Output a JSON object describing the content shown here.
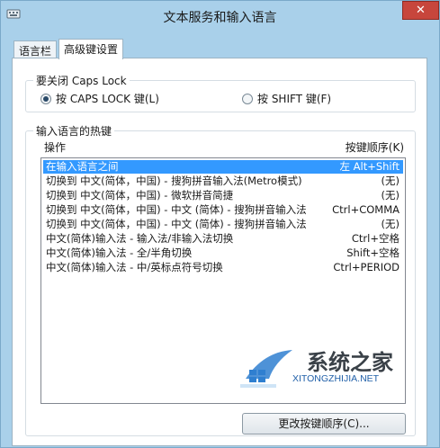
{
  "window": {
    "title": "文本服务和输入语言"
  },
  "tabs": [
    {
      "label": "语言栏"
    },
    {
      "label": "高级键设置"
    }
  ],
  "caps_lock": {
    "title": "要关闭 Caps Lock",
    "options": [
      {
        "label": "按 CAPS LOCK 键(L)",
        "checked": true
      },
      {
        "label": "按 SHIFT 键(F)",
        "checked": false
      }
    ]
  },
  "hotkeys": {
    "title": "输入语言的热键",
    "col_action": "操作",
    "col_keys": "按键顺序(K)",
    "rows": [
      {
        "action": "在输入语言之间",
        "keys": "左 Alt+Shift",
        "selected": true
      },
      {
        "action": "切换到 中文(简体，中国) - 搜狗拼音输入法(Metro模式)",
        "keys": "(无)"
      },
      {
        "action": "切换到 中文(简体，中国) - 微软拼音简捷",
        "keys": "(无)"
      },
      {
        "action": "切换到 中文(简体，中国) - 中文 (简体) - 搜狗拼音输入法",
        "keys": "Ctrl+COMMA"
      },
      {
        "action": "切换到 中文(简体，中国) - 中文 (简体) - 搜狗拼音输入法",
        "keys": "(无)"
      },
      {
        "action": "中文(简体)输入法 - 输入法/非输入法切换",
        "keys": "Ctrl+空格"
      },
      {
        "action": "中文(简体)输入法 - 全/半角切换",
        "keys": "Shift+空格"
      },
      {
        "action": "中文(简体)输入法 - 中/英标点符号切换",
        "keys": "Ctrl+PERIOD"
      }
    ],
    "change_button": "更改按键顺序(C)..."
  },
  "watermark": {
    "text": "系统之家",
    "url": "XITONGZHIJIA.NET"
  },
  "colors": {
    "frame": "#a9d0ea",
    "selection": "#3399ff",
    "close": "#c7463c"
  }
}
